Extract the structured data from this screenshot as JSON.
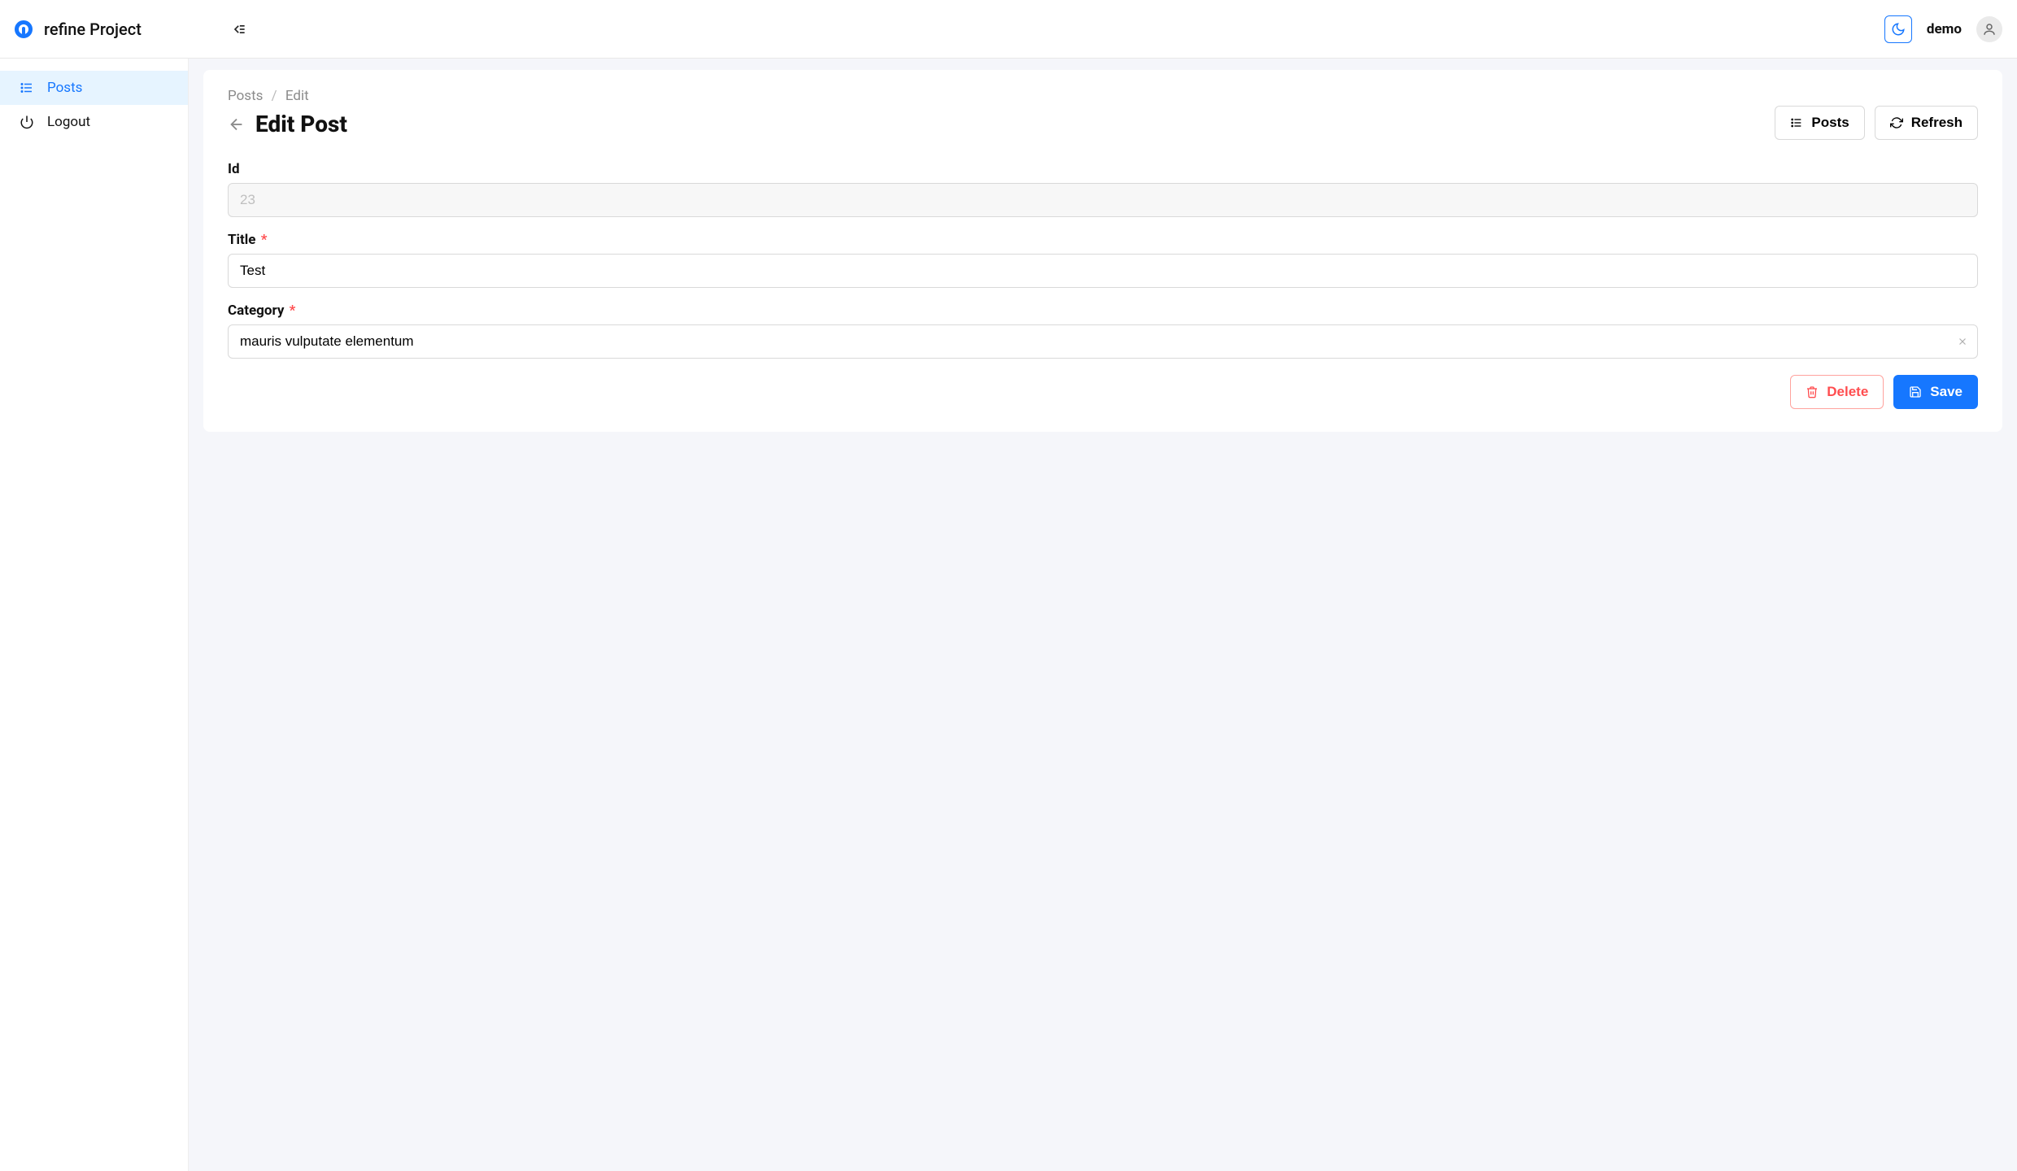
{
  "header": {
    "brand": "refine Project",
    "user": "demo"
  },
  "sidebar": {
    "items": [
      {
        "label": "Posts",
        "active": true
      },
      {
        "label": "Logout",
        "active": false
      }
    ]
  },
  "breadcrumb": {
    "root": "Posts",
    "sep": "/",
    "current": "Edit"
  },
  "page": {
    "title": "Edit Post",
    "list_button": "Posts",
    "refresh_button": "Refresh"
  },
  "form": {
    "id": {
      "label": "Id",
      "value": "23"
    },
    "title": {
      "label": "Title",
      "required": "*",
      "value": "Test"
    },
    "category": {
      "label": "Category",
      "required": "*",
      "value": "mauris vulputate elementum"
    }
  },
  "actions": {
    "delete": "Delete",
    "save": "Save"
  }
}
